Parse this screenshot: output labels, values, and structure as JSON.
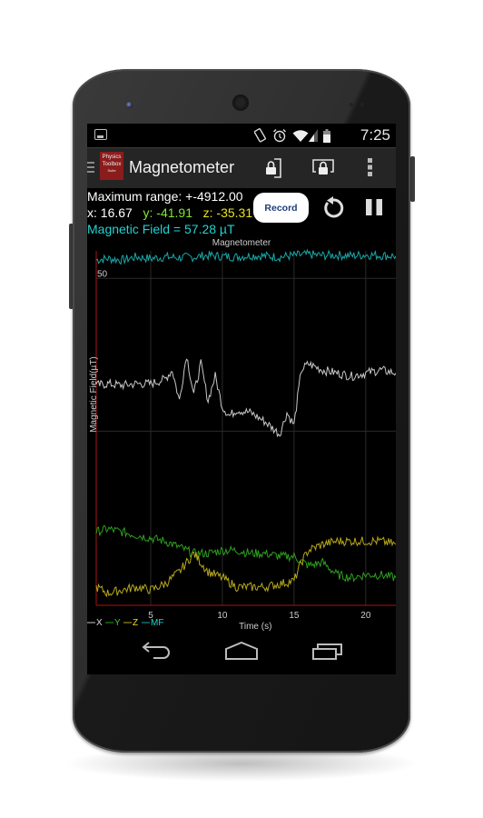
{
  "status_bar": {
    "time": "7:25",
    "icons": [
      "image-notification-icon",
      "rotate-icon",
      "alarm-icon",
      "wifi-icon",
      "signal-icon",
      "battery-icon"
    ]
  },
  "action_bar": {
    "logo_lines": [
      "Physics",
      "Toolbox",
      "Suite"
    ],
    "title": "Magnetometer",
    "actions": [
      "lock-screen-orientation",
      "lock-display",
      "overflow-menu"
    ]
  },
  "readout": {
    "max_range": "Maximum range: +-4912.00",
    "x": "x: 16.67",
    "y": "y: -41.91",
    "z": "z: -35.31",
    "magnetic_field": "Magnetic Field = 57.28 µT",
    "record_label": "Record"
  },
  "colors": {
    "x": "#c8c8c8",
    "y": "#2e9e1f",
    "z": "#b5a81c",
    "mf": "#1aa8a8",
    "readout_y": "#7fe832",
    "readout_z": "#e8e21c",
    "readout_mf": "#22d3d3",
    "axis": "#8b0f0f"
  },
  "chart_data": {
    "type": "line",
    "title": "Magnetometer",
    "xlabel": "Time (s)",
    "ylabel": "Magnetic Field(µT)",
    "x_ticks": [
      5,
      10,
      15,
      20
    ],
    "y_ticks": [
      50
    ],
    "xlim": [
      1.2,
      22.1
    ],
    "ylim": [
      -57,
      59
    ],
    "grid": true,
    "legend": [
      "X",
      "Y",
      "Z",
      "MF"
    ],
    "legend_position": "bottom-left",
    "series": [
      {
        "name": "MF",
        "key": "mf",
        "x": [
          1.2,
          2,
          3,
          4,
          5,
          6,
          7,
          8,
          9,
          10,
          11,
          12,
          13,
          14,
          15,
          16,
          17,
          18,
          19,
          20,
          21,
          22.1
        ],
        "values": [
          56,
          56.5,
          56,
          57,
          56.5,
          57,
          56.8,
          57,
          57.5,
          57.2,
          57,
          57.5,
          57.3,
          57,
          57.5,
          57.8,
          57.5,
          57.6,
          57.4,
          57.7,
          57.5,
          57.3
        ]
      },
      {
        "name": "X",
        "key": "x",
        "x": [
          1.2,
          2,
          3,
          4,
          5,
          6,
          6.5,
          7,
          7.5,
          8,
          8.5,
          9,
          9.5,
          10,
          10.5,
          11,
          12,
          13,
          14,
          14.5,
          15,
          15.5,
          16,
          17,
          18,
          19,
          20,
          21,
          22.1
        ],
        "values": [
          15,
          15.5,
          15,
          15.5,
          15.5,
          17,
          20,
          10,
          25,
          12,
          22,
          10,
          18,
          8,
          5,
          7,
          6,
          3,
          -1,
          6,
          2,
          20,
          22,
          20,
          19,
          18,
          19,
          20,
          19
        ]
      },
      {
        "name": "Y",
        "key": "y",
        "x": [
          1.2,
          2,
          3,
          4,
          5,
          6,
          7,
          8,
          9,
          10,
          11,
          12,
          13,
          14,
          15,
          16,
          17,
          18,
          19,
          20,
          21,
          22.1
        ],
        "values": [
          -33,
          -32,
          -33,
          -34,
          -35,
          -36,
          -38,
          -40,
          -40,
          -39,
          -39,
          -40,
          -40,
          -41,
          -41,
          -44,
          -43,
          -47,
          -48,
          -47,
          -47,
          -48
        ]
      },
      {
        "name": "Z",
        "key": "z",
        "x": [
          1.2,
          2,
          3,
          4,
          5,
          6,
          7,
          8,
          8.5,
          9,
          10,
          11,
          12,
          13,
          14,
          15,
          15.5,
          16,
          17,
          18,
          19,
          20,
          21,
          22.1
        ],
        "values": [
          -51,
          -53,
          -52,
          -51,
          -52,
          -50,
          -46,
          -40,
          -43,
          -46,
          -48,
          -51,
          -51,
          -51,
          -50,
          -49,
          -43,
          -39,
          -37,
          -36,
          -36,
          -36,
          -36,
          -37
        ]
      }
    ]
  },
  "nav_bar": {
    "buttons": [
      "back",
      "home",
      "recents"
    ]
  }
}
